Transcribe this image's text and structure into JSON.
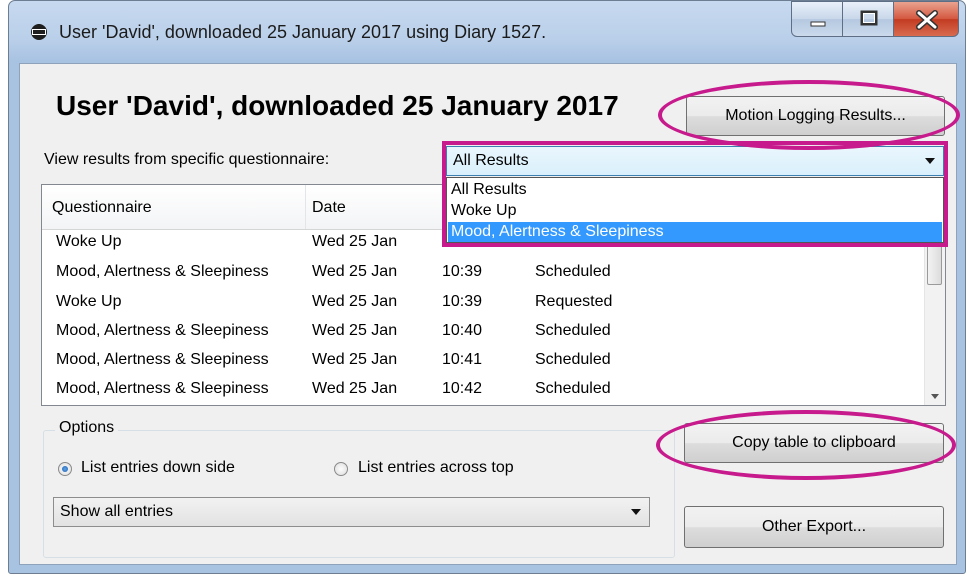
{
  "window": {
    "title": "User 'David', downloaded 25 January 2017 using Diary 1527."
  },
  "heading": "User 'David', downloaded 25 January 2017",
  "buttons": {
    "motion_logging": "Motion Logging Results...",
    "copy_table": "Copy table to clipboard",
    "other_export": "Other Export..."
  },
  "questionnaire_filter": {
    "label": "View results from specific questionnaire:",
    "selected": "All Results",
    "options": [
      "All Results",
      "Woke Up",
      "Mood, Alertness & Sleepiness"
    ],
    "highlighted_option": "Mood, Alertness & Sleepiness"
  },
  "table": {
    "columns": [
      "Questionnaire",
      "Date"
    ],
    "rows": [
      {
        "questionnaire": "Woke Up",
        "date": "Wed 25 Jan",
        "time": "",
        "type": ""
      },
      {
        "questionnaire": "Mood, Alertness & Sleepiness",
        "date": "Wed 25 Jan",
        "time": "10:39",
        "type": "Scheduled"
      },
      {
        "questionnaire": "Woke Up",
        "date": "Wed 25 Jan",
        "time": "10:39",
        "type": "Requested"
      },
      {
        "questionnaire": "Mood, Alertness & Sleepiness",
        "date": "Wed 25 Jan",
        "time": "10:40",
        "type": "Scheduled"
      },
      {
        "questionnaire": "Mood, Alertness & Sleepiness",
        "date": "Wed 25 Jan",
        "time": "10:41",
        "type": "Scheduled"
      },
      {
        "questionnaire": "Mood, Alertness & Sleepiness",
        "date": "Wed 25 Jan",
        "time": "10:42",
        "type": "Scheduled"
      }
    ]
  },
  "options": {
    "title": "Options",
    "radio_down": "List entries down side",
    "radio_across": "List entries across top",
    "selected_radio": "List entries down side",
    "show_select": "Show all entries"
  },
  "colors": {
    "annotation": "#c71a8c",
    "selection": "#3399ff"
  },
  "icons": [
    "app-icon",
    "minimize-icon",
    "maximize-icon",
    "close-icon",
    "chevron-down-icon"
  ]
}
